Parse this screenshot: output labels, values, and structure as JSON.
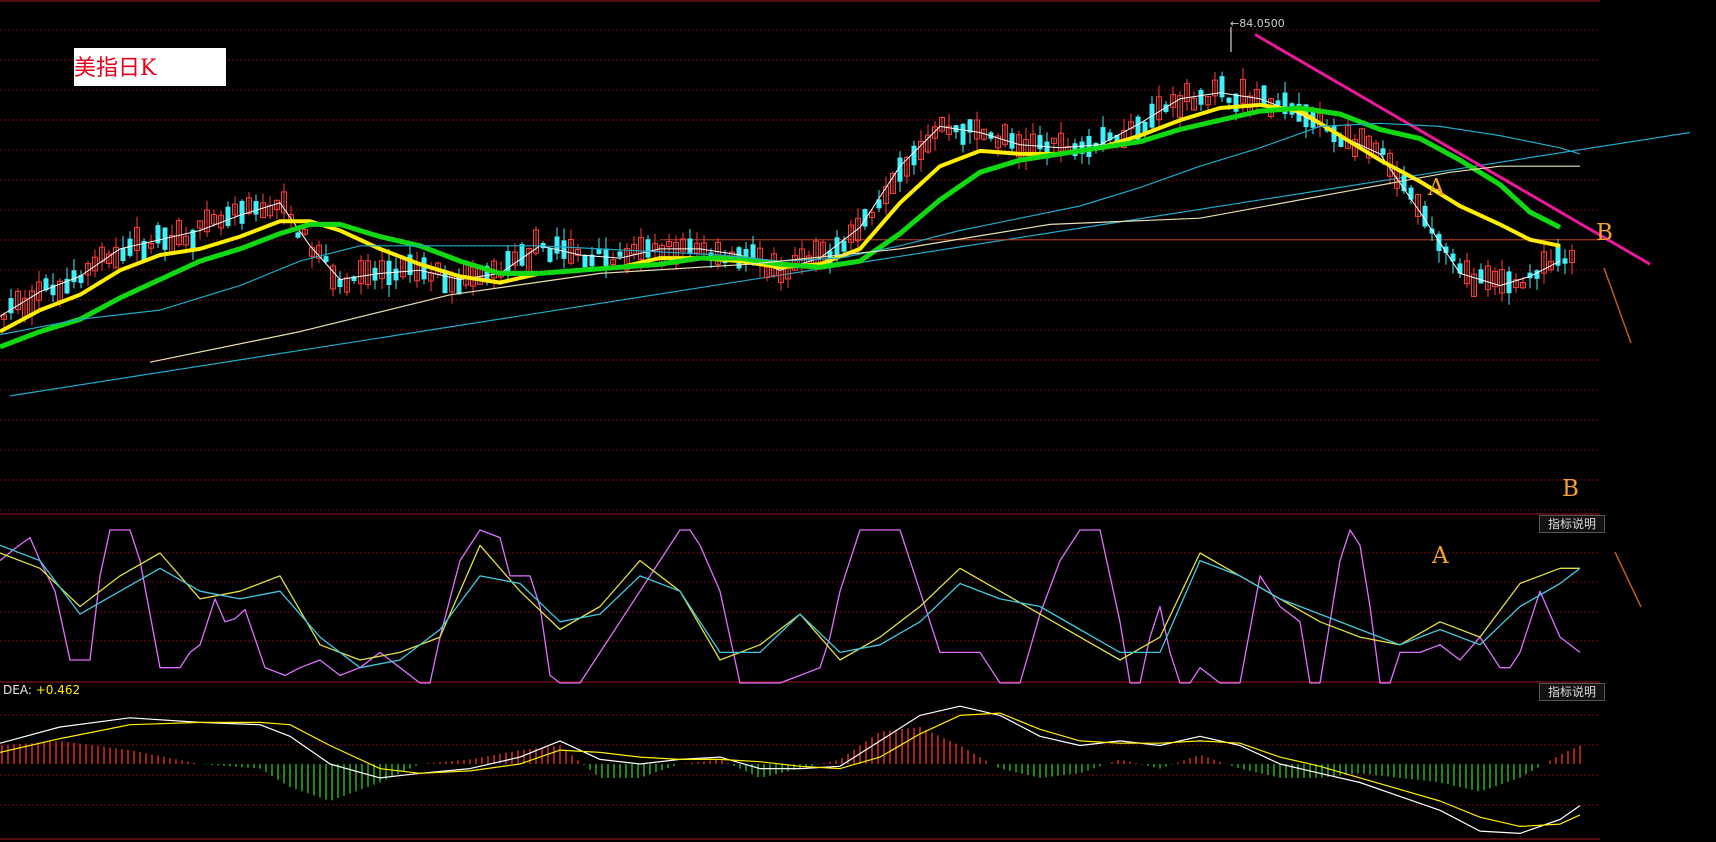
{
  "title": "美指日K",
  "max_label": "84.0500",
  "indicator_button_label": "指标说明",
  "dea": {
    "label": "DEA:",
    "value": "+0.462"
  },
  "annotations": {
    "A": "A",
    "B": "B"
  },
  "colors": {
    "background": "#000000",
    "grid": "#6e0a0a",
    "up": "#ff3b3b",
    "down": "#3ff0f8",
    "ma_fast": "#ffffff",
    "ma_yellow": "#ffee00",
    "ma_green": "#11d911",
    "ma_teal": "#20a9c8",
    "ma_long": "#e9dfb0",
    "trend_magenta": "#e8199a",
    "kdj_j": "#e070ff",
    "kdj_d": "#e0e040",
    "kdj_k": "#40c8e0",
    "macd_pos": "#e83020",
    "macd_neg": "#22c022",
    "annotation": "#f5a030",
    "title_text": "#e8001a"
  },
  "chart_data": [
    {
      "type": "candlestick",
      "title": "美指日K",
      "series": [
        {
          "name": "MA fast",
          "x": [
            0,
            40,
            80,
            120,
            160,
            200,
            240,
            280,
            310,
            340,
            380,
            420,
            460,
            500,
            540,
            580,
            620,
            660,
            700,
            740,
            780,
            820,
            860,
            900,
            940,
            980,
            1020,
            1060,
            1100,
            1140,
            1180,
            1220,
            1260,
            1300,
            1340,
            1380,
            1420,
            1460,
            1500,
            1530,
            1560
          ],
          "y": [
            95.5,
            96.3,
            96.8,
            97.7,
            98.0,
            98.3,
            98.8,
            99.2,
            97.8,
            96.7,
            96.9,
            97.0,
            96.7,
            96.9,
            97.8,
            97.5,
            97.4,
            97.7,
            97.7,
            97.5,
            97.0,
            97.4,
            98.4,
            100.4,
            101.7,
            101.5,
            101.1,
            101.0,
            101.1,
            101.8,
            102.6,
            102.8,
            102.6,
            102.1,
            101.4,
            100.8,
            98.9,
            96.9,
            96.5,
            96.8,
            97.3
          ]
        },
        {
          "name": "MA yellow",
          "x": [
            0,
            40,
            80,
            120,
            160,
            200,
            240,
            280,
            310,
            340,
            380,
            420,
            460,
            500,
            540,
            580,
            620,
            660,
            700,
            740,
            780,
            820,
            860,
            900,
            940,
            980,
            1020,
            1060,
            1100,
            1140,
            1180,
            1220,
            1260,
            1300,
            1340,
            1380,
            1420,
            1460,
            1500,
            1530,
            1560
          ],
          "y": [
            95.0,
            95.7,
            96.2,
            97.0,
            97.5,
            97.7,
            98.1,
            98.6,
            98.6,
            98.3,
            97.7,
            97.2,
            96.8,
            96.6,
            96.9,
            97.0,
            97.1,
            97.4,
            97.4,
            97.3,
            97.1,
            97.2,
            97.7,
            99.2,
            100.4,
            100.9,
            100.8,
            100.8,
            101.0,
            101.4,
            101.9,
            102.3,
            102.4,
            102.2,
            101.4,
            100.6,
            99.9,
            99.1,
            98.5,
            98.0,
            97.8
          ]
        },
        {
          "name": "MA green",
          "x": [
            0,
            40,
            80,
            120,
            160,
            200,
            240,
            280,
            310,
            340,
            380,
            420,
            460,
            500,
            540,
            580,
            620,
            660,
            700,
            740,
            780,
            820,
            860,
            900,
            940,
            980,
            1020,
            1060,
            1100,
            1140,
            1180,
            1220,
            1260,
            1300,
            1340,
            1380,
            1420,
            1460,
            1500,
            1530,
            1560
          ],
          "y": [
            94.5,
            95.0,
            95.4,
            96.1,
            96.7,
            97.3,
            97.7,
            98.2,
            98.5,
            98.5,
            98.1,
            97.8,
            97.3,
            96.9,
            96.9,
            97.0,
            97.1,
            97.2,
            97.4,
            97.4,
            97.2,
            97.1,
            97.3,
            98.2,
            99.3,
            100.2,
            100.6,
            100.8,
            101.0,
            101.2,
            101.6,
            101.9,
            102.2,
            102.3,
            102.1,
            101.6,
            101.3,
            100.6,
            99.8,
            98.9,
            98.4
          ]
        },
        {
          "name": "MA teal",
          "x": [
            0,
            80,
            160,
            240,
            300,
            360,
            420,
            480,
            540,
            600,
            660,
            720,
            780,
            840,
            900,
            960,
            1020,
            1080,
            1140,
            1200,
            1260,
            1320,
            1380,
            1440,
            1500,
            1560,
            1580
          ],
          "y": [
            94.9,
            95.4,
            95.7,
            96.5,
            97.3,
            97.8,
            97.8,
            97.8,
            97.8,
            97.7,
            97.6,
            97.5,
            97.3,
            97.4,
            97.8,
            98.3,
            98.7,
            99.1,
            99.7,
            100.4,
            101.0,
            101.7,
            101.8,
            101.7,
            101.4,
            101.0,
            100.8
          ]
        },
        {
          "name": "MA long",
          "x": [
            150,
            300,
            450,
            600,
            750,
            900,
            1050,
            1200,
            1350,
            1450,
            1500,
            1580
          ],
          "y": [
            94.0,
            95.0,
            96.2,
            96.9,
            97.2,
            97.7,
            98.5,
            98.7,
            99.6,
            100.2,
            100.4,
            100.4
          ]
        }
      ],
      "trendlines": [
        {
          "name": "support",
          "x": [
            10,
            1690
          ],
          "y": [
            92.9,
            101.5
          ]
        },
        {
          "name": "resistance",
          "x": [
            1255,
            1650
          ],
          "y": [
            104.7,
            97.2
          ]
        }
      ],
      "horizontal_line": {
        "y": 98.0,
        "x": [
          660,
          1600
        ]
      },
      "max_marker": {
        "x": 1231,
        "y": 104.95,
        "label": "84.0500"
      },
      "ylim": [
        89.5,
        105.5
      ],
      "grid": true
    },
    {
      "type": "line",
      "name": "KDJ",
      "ylim": [
        0,
        100
      ],
      "series": [
        {
          "name": "J",
          "x": [
            0,
            15,
            30,
            40,
            55,
            70,
            90,
            100,
            110,
            120,
            130,
            140,
            160,
            180,
            190,
            200,
            215,
            225,
            235,
            245,
            265,
            285,
            300,
            320,
            340,
            360,
            380,
            400,
            420,
            430,
            440,
            460,
            480,
            500,
            510,
            520,
            530,
            540,
            550,
            560,
            570,
            580,
            600,
            620,
            640,
            660,
            680,
            690,
            700,
            720,
            730,
            740,
            750,
            760,
            780,
            800,
            820,
            830,
            840,
            860,
            880,
            900,
            910,
            920,
            940,
            960,
            980,
            990,
            1000,
            1010,
            1020,
            1040,
            1060,
            1080,
            1090,
            1100,
            1110,
            1120,
            1130,
            1140,
            1150,
            1160,
            1170,
            1180,
            1190,
            1200,
            1220,
            1240,
            1260,
            1280,
            1300,
            1310,
            1320,
            1330,
            1340,
            1350,
            1360,
            1370,
            1380,
            1390,
            1400,
            1420,
            1440,
            1460,
            1480,
            1500,
            1510,
            1520,
            1530,
            1540,
            1560,
            1580
          ],
          "y": [
            80,
            88,
            95,
            80,
            60,
            15,
            15,
            70,
            100,
            100,
            100,
            80,
            10,
            10,
            20,
            25,
            55,
            40,
            42,
            48,
            10,
            5,
            10,
            15,
            5,
            10,
            20,
            10,
            0,
            0,
            30,
            80,
            100,
            95,
            70,
            70,
            70,
            50,
            5,
            0,
            0,
            0,
            20,
            40,
            60,
            80,
            100,
            100,
            90,
            60,
            30,
            0,
            0,
            0,
            0,
            5,
            10,
            30,
            60,
            100,
            100,
            100,
            80,
            60,
            20,
            20,
            20,
            10,
            0,
            0,
            0,
            45,
            80,
            100,
            100,
            100,
            70,
            40,
            0,
            0,
            30,
            50,
            20,
            0,
            0,
            10,
            0,
            0,
            70,
            50,
            40,
            0,
            0,
            40,
            80,
            100,
            90,
            50,
            0,
            0,
            20,
            20,
            25,
            15,
            30,
            10,
            10,
            20,
            40,
            60,
            30,
            20
          ]
        },
        {
          "name": "D",
          "x": [
            0,
            40,
            80,
            120,
            160,
            200,
            240,
            280,
            320,
            360,
            400,
            440,
            480,
            520,
            560,
            600,
            640,
            680,
            720,
            760,
            800,
            840,
            880,
            920,
            960,
            1000,
            1040,
            1080,
            1120,
            1160,
            1200,
            1240,
            1280,
            1320,
            1360,
            1400,
            1440,
            1480,
            1520,
            1560,
            1580
          ],
          "y": [
            85,
            75,
            50,
            70,
            85,
            55,
            60,
            70,
            25,
            15,
            20,
            30,
            90,
            60,
            35,
            50,
            80,
            60,
            15,
            25,
            45,
            15,
            30,
            50,
            75,
            60,
            45,
            30,
            15,
            30,
            85,
            70,
            55,
            40,
            30,
            25,
            40,
            30,
            65,
            75,
            75
          ]
        },
        {
          "name": "K",
          "x": [
            0,
            40,
            80,
            120,
            160,
            200,
            240,
            280,
            320,
            360,
            400,
            440,
            480,
            520,
            560,
            600,
            640,
            680,
            720,
            760,
            800,
            840,
            880,
            920,
            960,
            1000,
            1040,
            1080,
            1120,
            1160,
            1200,
            1240,
            1280,
            1320,
            1360,
            1400,
            1440,
            1480,
            1520,
            1560,
            1580
          ],
          "y": [
            90,
            80,
            45,
            60,
            75,
            60,
            55,
            60,
            30,
            10,
            15,
            35,
            70,
            65,
            40,
            45,
            70,
            60,
            20,
            20,
            45,
            20,
            25,
            40,
            65,
            55,
            50,
            35,
            20,
            20,
            80,
            70,
            55,
            45,
            35,
            25,
            35,
            25,
            50,
            65,
            75
          ]
        }
      ]
    },
    {
      "type": "bar",
      "name": "MACD",
      "ylim": [
        -1.6,
        1.6
      ],
      "line_series": [
        {
          "name": "DIF",
          "x": [
            0,
            60,
            130,
            200,
            260,
            290,
            330,
            380,
            420,
            470,
            520,
            560,
            600,
            640,
            680,
            720,
            760,
            800,
            840,
            880,
            920,
            960,
            1000,
            1040,
            1080,
            1120,
            1160,
            1200,
            1240,
            1280,
            1320,
            1360,
            1400,
            1440,
            1480,
            1520,
            1560,
            1580
          ],
          "y": [
            0.45,
            0.8,
            1.0,
            0.9,
            0.85,
            0.6,
            0.0,
            -0.3,
            -0.2,
            -0.1,
            0.15,
            0.5,
            0.1,
            0.0,
            0.1,
            0.15,
            -0.1,
            -0.1,
            -0.05,
            0.5,
            1.05,
            1.25,
            1.05,
            0.6,
            0.4,
            0.5,
            0.4,
            0.6,
            0.4,
            0.0,
            -0.2,
            -0.4,
            -0.7,
            -1.0,
            -1.45,
            -1.5,
            -1.2,
            -0.9
          ]
        },
        {
          "name": "DEA",
          "x": [
            0,
            60,
            130,
            200,
            260,
            290,
            330,
            380,
            420,
            470,
            520,
            560,
            600,
            640,
            680,
            720,
            760,
            800,
            840,
            880,
            920,
            960,
            1000,
            1040,
            1080,
            1120,
            1160,
            1200,
            1240,
            1280,
            1320,
            1360,
            1400,
            1440,
            1480,
            1520,
            1560,
            1580
          ],
          "y": [
            0.25,
            0.55,
            0.85,
            0.9,
            0.9,
            0.85,
            0.4,
            -0.1,
            -0.2,
            -0.15,
            0.0,
            0.3,
            0.25,
            0.15,
            0.1,
            0.1,
            0.05,
            -0.05,
            -0.1,
            0.15,
            0.65,
            1.05,
            1.1,
            0.75,
            0.5,
            0.45,
            0.45,
            0.5,
            0.45,
            0.15,
            -0.05,
            -0.3,
            -0.55,
            -0.8,
            -1.15,
            -1.35,
            -1.3,
            -1.1
          ]
        }
      ],
      "histogram_rule": "2 * (DIF - DEA) at every x step of 6",
      "grid": true
    }
  ]
}
